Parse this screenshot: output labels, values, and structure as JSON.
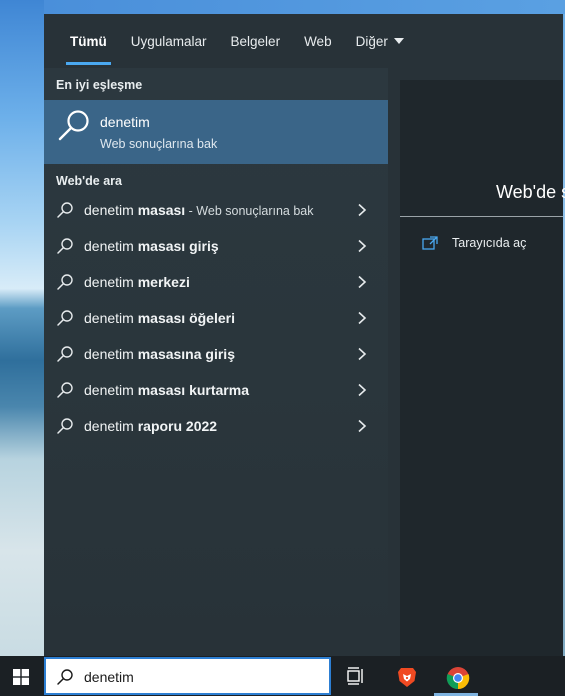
{
  "tabs": [
    {
      "label": "Tümü",
      "active": true
    },
    {
      "label": "Uygulamalar"
    },
    {
      "label": "Belgeler"
    },
    {
      "label": "Web"
    },
    {
      "label": "Diğer"
    }
  ],
  "best_match": {
    "section_label": "En iyi eşleşme",
    "title": "denetim",
    "subtitle": "Web sonuçlarına bak"
  },
  "web_search": {
    "section_label": "Web'de ara",
    "suggestions": [
      {
        "prefix": "denetim ",
        "bold": "masası",
        "hint": " - Web sonuçlarına bak"
      },
      {
        "prefix": "denetim ",
        "bold": "masası giriş",
        "hint": ""
      },
      {
        "prefix": "denetim ",
        "bold": "merkezi",
        "hint": ""
      },
      {
        "prefix": "denetim ",
        "bold": "masası öğeleri",
        "hint": ""
      },
      {
        "prefix": "denetim ",
        "bold": "masasına giriş",
        "hint": ""
      },
      {
        "prefix": "denetim ",
        "bold": "masası kurtarma",
        "hint": ""
      },
      {
        "prefix": "denetim ",
        "bold": "raporu 2022",
        "hint": ""
      }
    ]
  },
  "preview": {
    "title": "Web'de s",
    "open_in_browser": "Tarayıcıda aç"
  },
  "taskbar": {
    "search_value": "denetim",
    "apps": [
      "task-view",
      "brave",
      "chrome"
    ]
  },
  "colors": {
    "accent": "#4aa8f0",
    "selection": "#3a6588",
    "flyout_bg": "#283238",
    "taskbar_bg": "#1b2024",
    "search_border": "#2d7fd3"
  }
}
